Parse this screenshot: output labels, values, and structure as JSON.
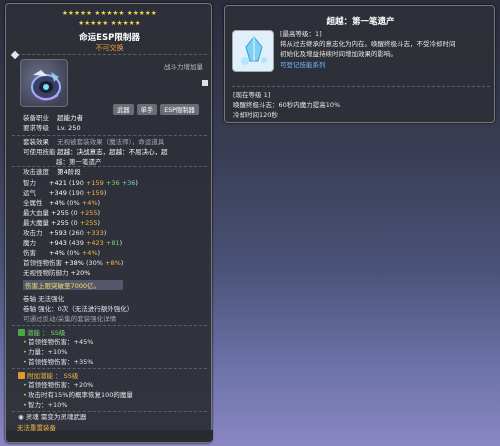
{
  "item": {
    "stars_row1": "★★★★★ ★★★★★ ★★★★★",
    "stars_row2": "★★★★★ ★★★★★",
    "name": "命运ESP限制器",
    "subtitle": "不可交换",
    "combat_label": "战斗力增加量",
    "tags": [
      "武器",
      "单手",
      "ESP限制器"
    ],
    "equip_job_label": "装备职业",
    "equip_job_value": "超能力者",
    "req_level_label": "要求等级",
    "req_level_value": "Lv. 250",
    "set_effect_label": "套装效果",
    "set_effect_value": "无视被套装效果（魔法师），命运道具",
    "skill_label": "可使用技能",
    "skill_value": "超越：决战意志，超越：不屈决心，超",
    "skill_value2": "越：第一笔遗产",
    "atk_speed_label": "攻击速度",
    "atk_speed_value": "第4阶段",
    "stats": [
      {
        "label": "智力",
        "total": "+421",
        "base": "190",
        "add1": "+159",
        "add2": "+36",
        "add3": "+36"
      },
      {
        "label": "运气",
        "total": "+349",
        "base": "190",
        "add1": "+159",
        "add2": "",
        "add3": ""
      },
      {
        "label": "全属性",
        "total": "+4%",
        "base": "0%",
        "add1": "+4%",
        "add2": "",
        "add3": ""
      },
      {
        "label": "最大血量",
        "total": "+255",
        "base": "0",
        "add1": "+255",
        "add2": "",
        "add3": ""
      },
      {
        "label": "最大魔量",
        "total": "+255",
        "base": "0",
        "add1": "+255",
        "add2": "",
        "add3": ""
      },
      {
        "label": "攻击力",
        "total": "+593",
        "base": "260",
        "add1": "+333",
        "add2": "",
        "add3": ""
      },
      {
        "label": "魔力",
        "total": "+943",
        "base": "439",
        "add1": "+423",
        "add2": "+81",
        "add3": ""
      },
      {
        "label": "伤害",
        "total": "+4%",
        "base": "0%",
        "add1": "+4%",
        "add2": "",
        "add3": ""
      },
      {
        "label": "首领怪物伤害",
        "total": "+38%",
        "base": "30%",
        "add1": "+8%",
        "add2": "",
        "add3": ""
      },
      {
        "label": "无视怪物防御力",
        "total": "+20%",
        "base": "",
        "add1": "",
        "add2": "",
        "add3": ""
      }
    ],
    "damage_cap": "伤害上限突破至7000亿。",
    "scissors_label": "卷轴",
    "scissors_value": "无法强化",
    "upgrade_label": "卷轴",
    "upgrade_value": "强化：0次（无法进行额外强化）",
    "tradable_note": "可通过反动/采集的套装强化详情",
    "potential_title": "潜能 ： SS级",
    "potential_lines": [
      "首领怪物伤害：+45%",
      "力量：+10%",
      "首领怪物伤害：+35%"
    ],
    "bonus_title": "附加潜能 ： SS级",
    "bonus_lines": [
      "首领怪物伤害：+20%",
      "攻击时有15%的概率恢复100的魔量",
      "智力：+10%"
    ],
    "soul_label": "灵魂",
    "soul_value": "需变为灵魂武器",
    "bottom_note": "无法重置装备"
  },
  "skill": {
    "title": "超越：第一笔遗产",
    "level_line": "[最高等级：1]",
    "desc_line1": "将从过去继承的意志化为内在。唤醒终极斗志，不受冷却时间",
    "desc_line2": "初始化及增益持续时间增加效果的影响。",
    "link": "可登记技能系列",
    "current_level": "[现在等级 1]",
    "current_effect": "唤醒终极斗志：60秒内魔力提高10%",
    "cooldown": "冷却时间120秒"
  },
  "colors": {
    "gold": "#f0b83a",
    "green": "#7ad46b",
    "cyan": "#64d6d6",
    "blue_link": "#6bb8ff",
    "subtitle_orange": "#f0a040"
  }
}
